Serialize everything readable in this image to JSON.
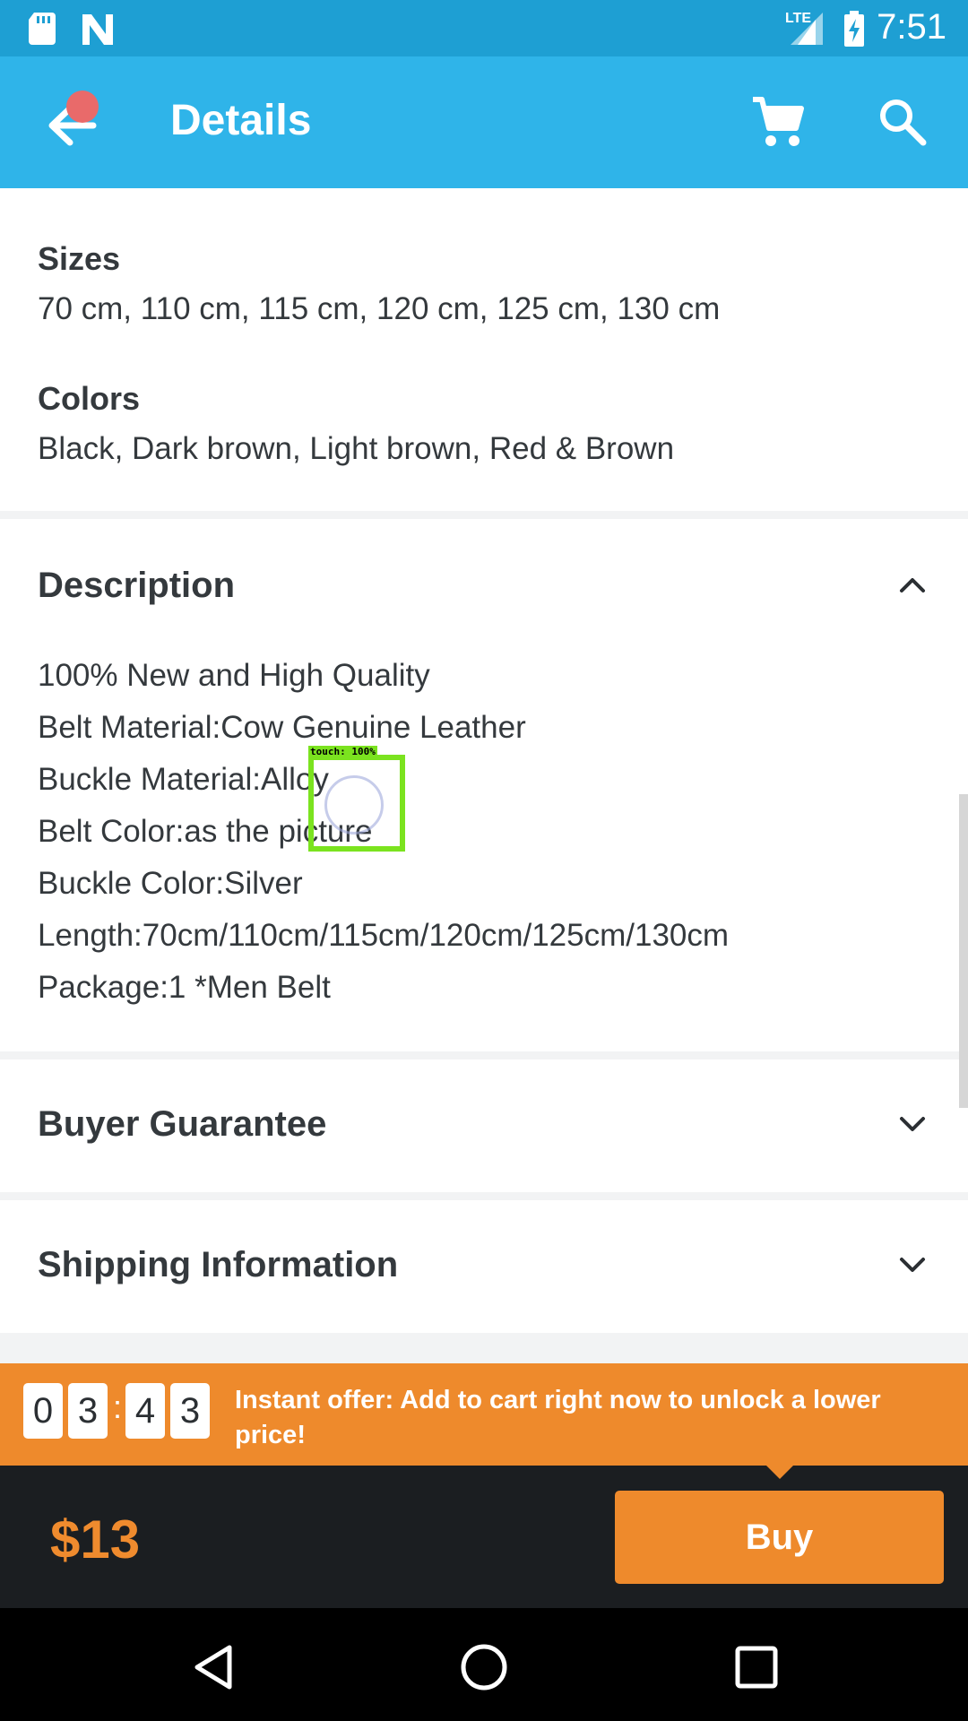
{
  "status_bar": {
    "time": "7:51",
    "network": "LTE",
    "icons": [
      "sd-card-icon",
      "n-notification-icon",
      "signal-icon",
      "battery-charging-icon"
    ]
  },
  "header": {
    "title": "Details",
    "back_icon": "arrow-left-icon",
    "cart_icon": "cart-icon",
    "search_icon": "search-icon",
    "notification_dot_color": "#e96a6a"
  },
  "specs": {
    "sizes_label": "Sizes",
    "sizes_value": "70 cm, 110 cm, 115 cm, 120 cm, 125 cm, 130 cm",
    "colors_label": "Colors",
    "colors_value": "Black, Dark brown, Light brown, Red & Brown"
  },
  "description": {
    "title": "Description",
    "expanded": true,
    "lines": [
      "100% New and High Quality",
      "Belt Material:Cow Genuine Leather",
      "Buckle Material:Alloy",
      "Belt Color:as the picture",
      "Buckle Color:Silver",
      "Length:70cm/110cm/115cm/120cm/125cm/130cm",
      "Package:1 *Men Belt"
    ]
  },
  "buyer_guarantee": {
    "title": "Buyer Guarantee",
    "expanded": false
  },
  "shipping": {
    "title": "Shipping Information",
    "expanded": false
  },
  "touch_overlay": {
    "label": "touch: 100%"
  },
  "offer": {
    "timer_digits": [
      "0",
      "3",
      "4",
      "3"
    ],
    "separator": ":",
    "text": "Instant offer: Add to cart right now to unlock a lower price!",
    "color": "#ee8a2c"
  },
  "purchase": {
    "price": "$13",
    "buy_label": "Buy"
  },
  "colors": {
    "app_bar": "#2fb4e9",
    "status_bar": "#1e9fd3",
    "accent_orange": "#ee8a2c",
    "dark_bar": "#1b1e21"
  }
}
